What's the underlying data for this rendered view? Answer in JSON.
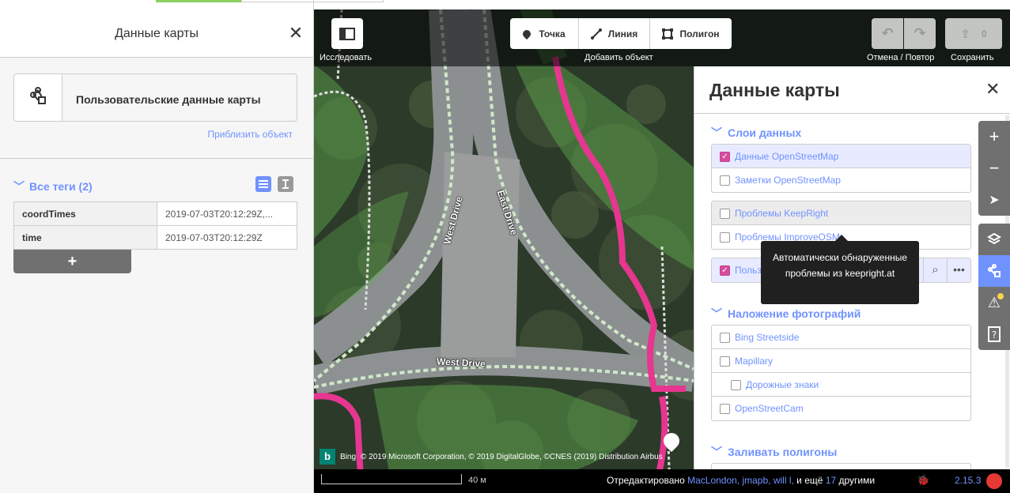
{
  "inspector": {
    "title": "Данные карты",
    "preset_label": "Пользовательские данные карты",
    "zoom_link": "Приблизить объект",
    "all_tags_label": "Все теги (2)",
    "tags": [
      {
        "key": "coordTimes",
        "value": "2019-07-03T20:12:29Z,..."
      },
      {
        "key": "time",
        "value": "2019-07-03T20:12:29Z"
      }
    ],
    "add_tag_label": "+"
  },
  "toolbar": {
    "explore_caption": "Исследовать",
    "point_label": "Точка",
    "line_label": "Линия",
    "polygon_label": "Полигон",
    "add_feature_caption": "Добавить объект",
    "undo_redo_caption": "Отмена / Повтор",
    "save_caption": "Сохранить",
    "save_count": "0"
  },
  "map_data_panel": {
    "title": "Данные карты",
    "data_layers_label": "Слои данных",
    "layers_group1": [
      {
        "label": "Данные OpenStreetMap",
        "checked": true
      },
      {
        "label": "Заметки OpenStreetMap",
        "checked": false
      }
    ],
    "layers_group2": [
      {
        "label": "Проблемы KeepRight",
        "checked": false
      },
      {
        "label": "Проблемы ImproveOSM",
        "checked": false
      }
    ],
    "custom_layer_label": "Пользо",
    "photo_overlays_label": "Наложение фотографий",
    "photo_layers": [
      {
        "label": "Bing Streetside",
        "checked": false
      },
      {
        "label": "Mapillary",
        "checked": false
      },
      {
        "label": "Дорожные знаки",
        "checked": false
      },
      {
        "label": "OpenStreetCam",
        "checked": false
      }
    ],
    "fill_areas_label": "Заливать полигоны"
  },
  "tooltip": {
    "text": "Автоматически обнаруженные проблемы из keepright.at"
  },
  "map_labels": {
    "west_drive_1": "West Drive",
    "east_drive": "East Drive",
    "west_drive_2": "West Drive"
  },
  "attribution": {
    "bing": "Bing",
    "text": "© 2019 Microsoft Corporation, © 2019 DigitalGlobe, ©CNES (2019) Distribution Airbus"
  },
  "footer": {
    "scale_label": "40 м",
    "edited_by_prefix": "Отредактировано",
    "edited_by_users": "MacLondon, jmapb, will l,",
    "edited_by_more": "и ещё",
    "edited_by_count": "17",
    "edited_by_suffix": "другими",
    "version": "2.15.3"
  },
  "colors": {
    "accent": "#7092ff",
    "highlight": "#e8ebff",
    "checkbox_on": "#d64d9e",
    "pink_outline": "#e6368f"
  }
}
